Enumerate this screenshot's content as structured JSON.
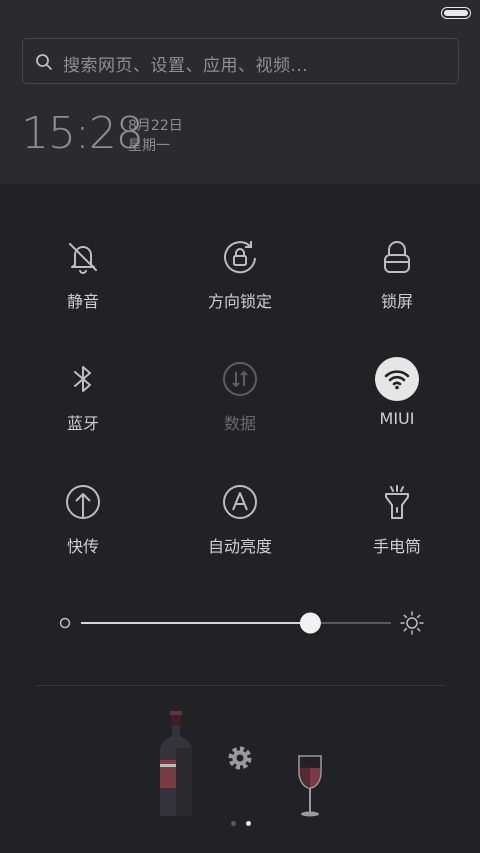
{
  "search": {
    "placeholder": "搜索网页、设置、应用、视频..."
  },
  "clock": {
    "time": "15:28",
    "date": "8月22日",
    "weekday": "星期一"
  },
  "toggles": [
    {
      "label": "静音",
      "icon": "mute-bell-icon",
      "state": "off"
    },
    {
      "label": "方向锁定",
      "icon": "rotation-lock-icon",
      "state": "off"
    },
    {
      "label": "锁屏",
      "icon": "lock-icon",
      "state": "off"
    },
    {
      "label": "蓝牙",
      "icon": "bluetooth-icon",
      "state": "off"
    },
    {
      "label": "数据",
      "icon": "mobile-data-icon",
      "state": "disabled"
    },
    {
      "label": "MIUI",
      "icon": "wifi-icon",
      "state": "on"
    },
    {
      "label": "快传",
      "icon": "quick-transfer-icon",
      "state": "off"
    },
    {
      "label": "自动亮度",
      "icon": "auto-brightness-icon",
      "state": "off"
    },
    {
      "label": "手电筒",
      "icon": "flashlight-icon",
      "state": "off"
    }
  ],
  "brightness": {
    "level": 0.74
  },
  "pager": {
    "count": 2,
    "active": 1
  },
  "colors": {
    "background": "#222226",
    "panel": "#2b2b2f",
    "text": "#cfcfd2",
    "active_bg": "#e6e6e6"
  }
}
